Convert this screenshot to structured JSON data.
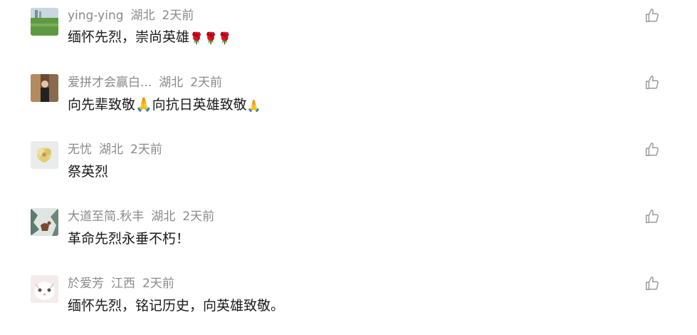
{
  "comments": [
    {
      "nickname": "ying-ying",
      "location": "湖北",
      "time": "2天前",
      "text": "缅怀先烈，崇尚英雄",
      "emoji": "🌹🌹🌹",
      "avatar": "avatar-green-field"
    },
    {
      "nickname": "爱拼才会赢白...",
      "location": "湖北",
      "time": "2天前",
      "text": "向先辈致敬🙏向抗日英雄致敬",
      "emoji": "🙏",
      "avatar": "avatar-person-indoor"
    },
    {
      "nickname": "无忧",
      "location": "湖北",
      "time": "2天前",
      "text": "祭英烈",
      "emoji": "",
      "avatar": "avatar-yellow-flower"
    },
    {
      "nickname": "大道至简.秋丰",
      "location": "湖北",
      "time": "2天前",
      "text": "革命先烈永垂不朽！",
      "emoji": "",
      "avatar": "avatar-deer-snow"
    },
    {
      "nickname": "於爱芳",
      "location": "江西",
      "time": "2天前",
      "text": "缅怀先烈，铭记历史，向英雄致敬。",
      "emoji": "",
      "avatar": "avatar-cat-white"
    }
  ],
  "icons": {
    "like": "thumbs-up-icon"
  },
  "colors": {
    "meta_text": "#8a8a8a",
    "body_text": "#1a1a1a",
    "icon_stroke": "#9a9a9a"
  }
}
